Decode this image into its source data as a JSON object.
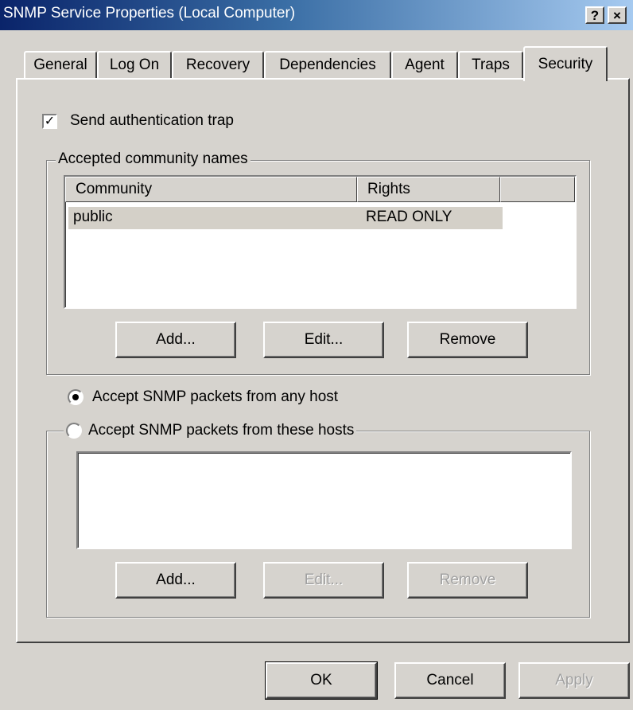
{
  "window": {
    "title": "SNMP Service Properties (Local Computer)",
    "help_button": "?",
    "close_button": "×"
  },
  "tabs": [
    {
      "label": "General"
    },
    {
      "label": "Log On"
    },
    {
      "label": "Recovery"
    },
    {
      "label": "Dependencies"
    },
    {
      "label": "Agent"
    },
    {
      "label": "Traps"
    },
    {
      "label": "Security",
      "active": true
    }
  ],
  "security": {
    "send_auth_trap": {
      "label": "Send authentication trap",
      "checked": true,
      "check_mark": "✓"
    },
    "community_group": {
      "legend": "Accepted community names",
      "columns": [
        "Community",
        "Rights"
      ],
      "rows": [
        {
          "community": "public",
          "rights": "READ ONLY",
          "selected": true
        }
      ],
      "buttons": {
        "add": "Add...",
        "edit": "Edit...",
        "remove": "Remove"
      }
    },
    "accept_any_host": {
      "label": "Accept SNMP packets from any host",
      "selected": true
    },
    "accept_these_hosts": {
      "label": "Accept SNMP packets from these hosts",
      "selected": false,
      "hosts": [],
      "buttons": {
        "add": "Add...",
        "edit": "Edit...",
        "remove": "Remove"
      }
    }
  },
  "footer": {
    "ok": "OK",
    "cancel": "Cancel",
    "apply": "Apply"
  }
}
